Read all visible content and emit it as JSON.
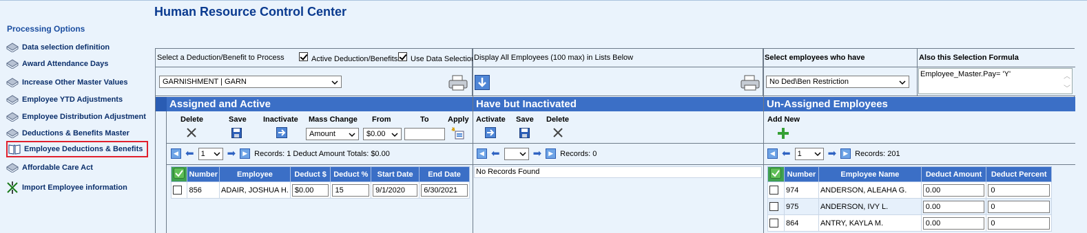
{
  "app": {
    "title": "Human Resource Control Center"
  },
  "sidebar": {
    "title": "Processing Options",
    "items": [
      {
        "label": "Data selection definition",
        "icon": "book-icon",
        "selected": false
      },
      {
        "label": "Award Attendance Days",
        "icon": "book-icon",
        "selected": false
      },
      {
        "label": "Increase Other Master Values",
        "icon": "book-icon",
        "selected": false
      },
      {
        "label": "Employee YTD Adjustments",
        "icon": "book-icon",
        "selected": false
      },
      {
        "label": "Employee Distribution Adjustment",
        "icon": "book-icon",
        "selected": false
      },
      {
        "label": "Deductions & Benefits Master",
        "icon": "book-icon",
        "selected": false
      },
      {
        "label": "Employee Deductions & Benefits",
        "icon": "open-book-icon",
        "selected": true
      },
      {
        "label": "Affordable Care Act",
        "icon": "book-icon",
        "selected": false
      },
      {
        "label": "Import Employee information",
        "icon": "import-arrows-icon",
        "selected": false
      }
    ]
  },
  "selection": {
    "deduction_label": "Select a Deduction/Benefit to Process",
    "active_checkbox_label": "Active Deduction/Benefits",
    "use_data_selection_label": "Use Data Selection",
    "deduction_value": "GARNISHMENT | GARN",
    "display_all_label": "Display All Employees (100 max) in Lists Below",
    "select_employees_label": "Select employees who have",
    "restriction_value": "No Ded\\Ben Restriction",
    "formula_label": "Also this Selection Formula",
    "formula_value": "Employee_Master.Pay= 'Y'"
  },
  "assigned": {
    "header": "Assigned and Active",
    "toolbar": {
      "delete": "Delete",
      "save": "Save",
      "inactivate": "Inactivate",
      "mass_change": "Mass Change",
      "from": "From",
      "to": "To",
      "apply": "Apply",
      "mass_change_value": "Amount",
      "from_value": "$0.00"
    },
    "pager": {
      "page": "1",
      "records": "Records: 1 Deduct Amount Totals: $0.00"
    },
    "columns": [
      "Number",
      "Employee",
      "Deduct $",
      "Deduct %",
      "Start Date",
      "End Date"
    ],
    "rows": [
      {
        "number": "856",
        "employee": "ADAIR, JOSHUA H.",
        "deduct_amt": "$0.00",
        "deduct_pct": "15",
        "start": "9/1/2020",
        "end": "6/30/2021"
      }
    ]
  },
  "inactivated": {
    "header": "Have but Inactivated",
    "toolbar": {
      "activate": "Activate",
      "save": "Save",
      "delete": "Delete"
    },
    "pager": {
      "records": "Records: 0"
    },
    "empty_text": "No Records Found"
  },
  "unassigned": {
    "header": "Un-Assigned Employees",
    "toolbar": {
      "add_new": "Add New"
    },
    "pager": {
      "page": "1",
      "records": "Records: 201"
    },
    "columns": [
      "Number",
      "Employee Name",
      "Deduct Amount",
      "Deduct Percent"
    ],
    "rows": [
      {
        "number": "974",
        "name": "ANDERSON, ALEAHA G.",
        "amount": "0.00",
        "percent": "0"
      },
      {
        "number": "975",
        "name": "ANDERSON, IVY L.",
        "amount": "0.00",
        "percent": "0"
      },
      {
        "number": "864",
        "name": "ANTRY, KAYLA M.",
        "amount": "0.00",
        "percent": "0"
      }
    ]
  },
  "colors": {
    "accent": "#3b6fc6",
    "title": "#0a3a8f",
    "selected_border": "#e01f2c",
    "background": "#eaf3fc"
  }
}
